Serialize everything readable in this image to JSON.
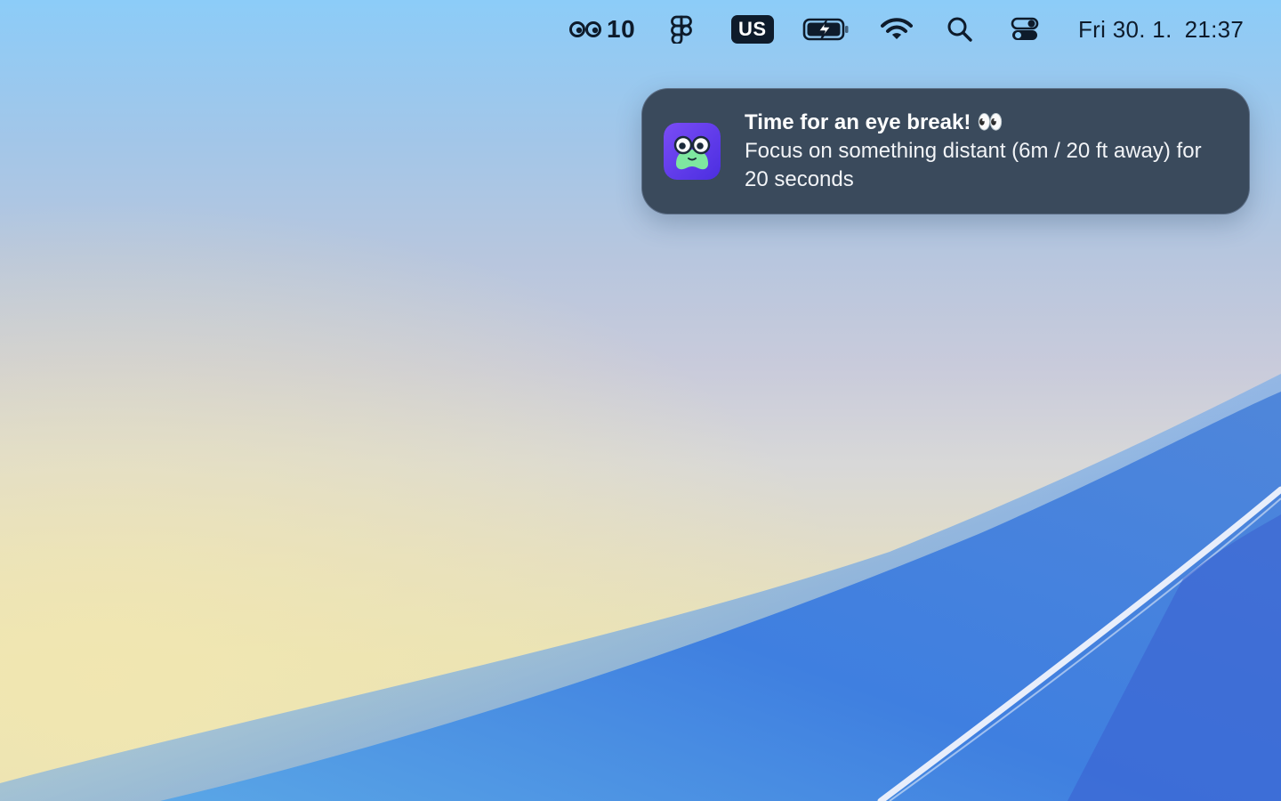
{
  "menubar": {
    "eye_counter": {
      "icon": "eyes-icon",
      "value": "10"
    },
    "figma": {
      "icon": "figma-icon"
    },
    "input_source": {
      "label": "US"
    },
    "battery": {
      "icon": "battery-charging-icon"
    },
    "wifi": {
      "icon": "wifi-icon"
    },
    "search": {
      "icon": "search-icon"
    },
    "control_center": {
      "icon": "control-center-icon"
    },
    "clock": {
      "date": "Fri 30. 1.",
      "time": "21:37"
    }
  },
  "notification": {
    "app_icon": "eye-break-app-icon",
    "title": "Time for an eye break! 👀",
    "body": "Focus on something distant (6m / 20 ft away) for 20 seconds"
  },
  "colors": {
    "menubar_text": "#0e1b2b",
    "notification_bg": "#3a4a5c",
    "app_icon_bg": "#6a3cf0",
    "app_icon_face": "#7ee7a0"
  }
}
